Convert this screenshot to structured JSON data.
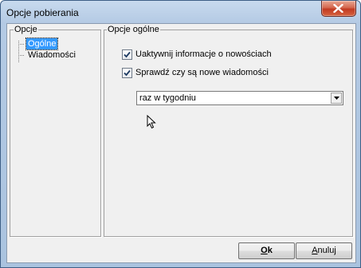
{
  "window": {
    "title": "Opcje pobierania"
  },
  "tree_panel": {
    "legend": "Opcje",
    "items": [
      {
        "label": "Ogólne",
        "selected": true
      },
      {
        "label": "Wiadomości",
        "selected": false
      }
    ]
  },
  "general_panel": {
    "legend": "Opcje ogólne",
    "options": [
      {
        "label": "Uaktywnij informacje o nowościach",
        "checked": true
      },
      {
        "label": "Sprawdź czy są nowe wiadomości",
        "checked": true
      }
    ],
    "frequency": {
      "value": "raz w tygodniu"
    }
  },
  "buttons": {
    "ok": {
      "mnemonic": "O",
      "rest": "k"
    },
    "cancel": {
      "mnemonic": "A",
      "rest": "nuluj"
    }
  },
  "colors": {
    "selection": "#3399ff",
    "titlebar": "#b4cae4",
    "close_button": "#c23a22"
  },
  "icons": {
    "close": "close-icon",
    "checkbox": "checkmark-icon",
    "dropdown": "chevron-down-icon",
    "cursor": "mouse-pointer-icon"
  }
}
